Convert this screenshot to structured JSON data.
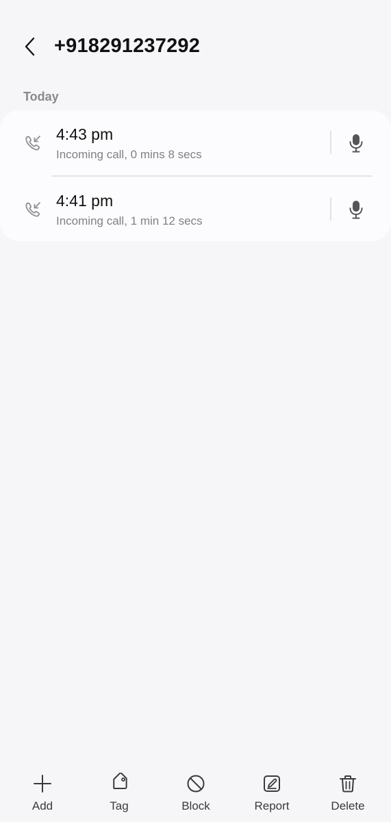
{
  "header": {
    "title": "+918291237292"
  },
  "section": {
    "label": "Today"
  },
  "calls": [
    {
      "time": "4:43 pm",
      "detail": "Incoming call, 0 mins 8 secs",
      "icon": "incoming-call-icon"
    },
    {
      "time": "4:41 pm",
      "detail": "Incoming call, 1 min 12 secs",
      "icon": "incoming-call-icon"
    }
  ],
  "toolbar": {
    "add": "Add",
    "tag": "Tag",
    "block": "Block",
    "report": "Report",
    "delete": "Delete"
  },
  "colors": {
    "background": "#f6f6f8",
    "card": "#fcfcfe",
    "icon": "#8e8e93",
    "text_secondary": "#808085"
  }
}
